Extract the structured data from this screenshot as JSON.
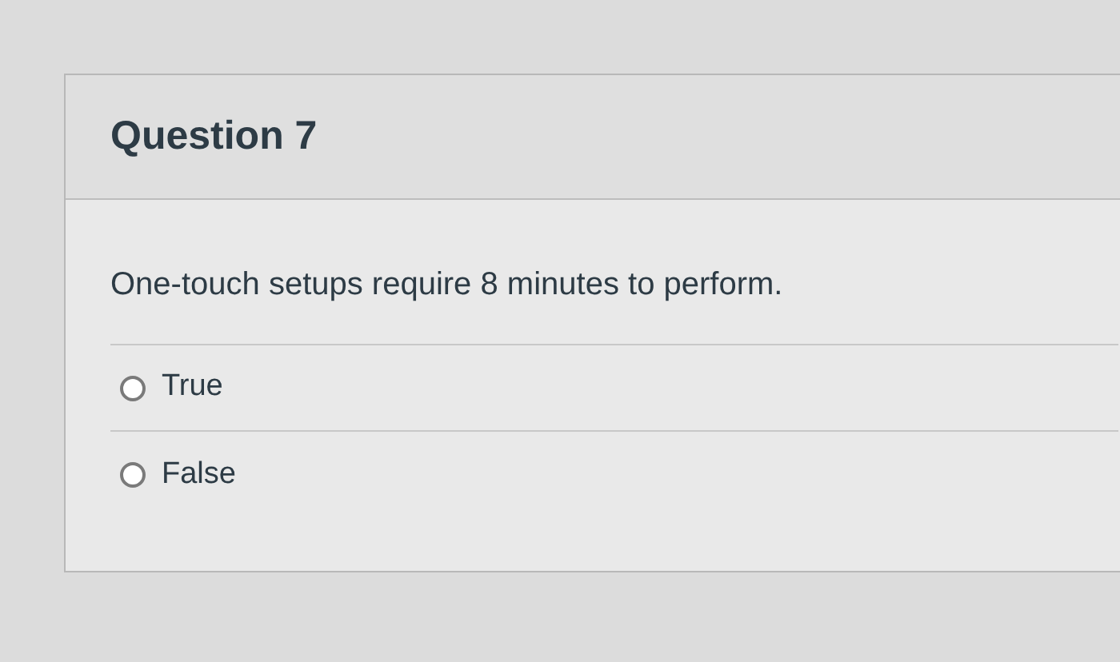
{
  "question": {
    "title": "Question 7",
    "text": "One-touch setups require 8 minutes to perform.",
    "options": [
      {
        "label": "True",
        "selected": false
      },
      {
        "label": "False",
        "selected": false
      }
    ]
  }
}
